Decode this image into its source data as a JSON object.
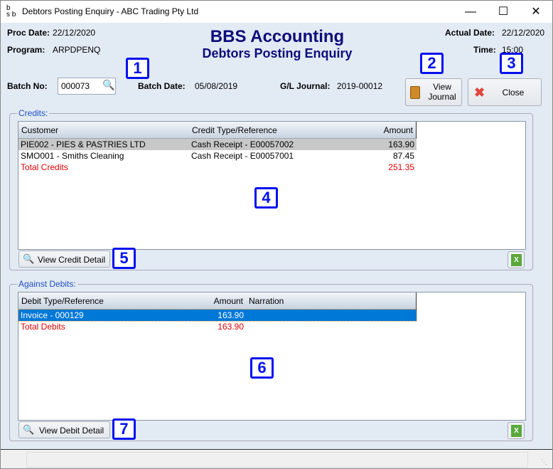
{
  "window": {
    "title": "Debtors Posting Enquiry - ABC Trading Pty Ltd",
    "logo": "bsb"
  },
  "header": {
    "proc_date_label": "Proc Date:",
    "proc_date": "22/12/2020",
    "program_label": "Program:",
    "program": "ARPDPENQ",
    "app_title": "BBS Accounting",
    "screen_title": "Debtors Posting Enquiry",
    "actual_date_label": "Actual Date:",
    "actual_date": "22/12/2020",
    "time_label": "Time:",
    "time": "15:00"
  },
  "batch": {
    "batch_no_label": "Batch No:",
    "batch_no": "000073",
    "batch_date_label": "Batch Date:",
    "batch_date": "05/08/2019",
    "gl_journal_label": "G/L Journal:",
    "gl_journal": "2019-00012"
  },
  "buttons": {
    "view_journal": "View Journal",
    "close": "Close",
    "view_credit_detail": "View Credit Detail",
    "view_debit_detail": "View Debit Detail"
  },
  "credits": {
    "legend": "Credits:",
    "columns": [
      "Customer",
      "Credit Type/Reference",
      "Amount"
    ],
    "rows": [
      [
        "PIE002 -  PIES & PASTRIES LTD",
        "Cash Receipt - E00057002",
        "163.90"
      ],
      [
        "SMO001 -  Smiths Cleaning",
        "Cash Receipt - E00057001",
        "87.45"
      ]
    ],
    "total_label": "Total Credits",
    "total": "251.35"
  },
  "debits": {
    "legend": "Against Debits:",
    "columns": [
      "Debit Type/Reference",
      "Amount",
      "Narration"
    ],
    "rows": [
      [
        "Invoice - 000129",
        "163.90",
        ""
      ]
    ],
    "total_label": "Total Debits",
    "total": "163.90"
  },
  "badges": [
    "1",
    "2",
    "3",
    "4",
    "5",
    "6",
    "7"
  ],
  "colors": {
    "title": "#0d0d7a",
    "total": "#e00000",
    "selected": "#0078d7",
    "legend": "#2050c0"
  }
}
